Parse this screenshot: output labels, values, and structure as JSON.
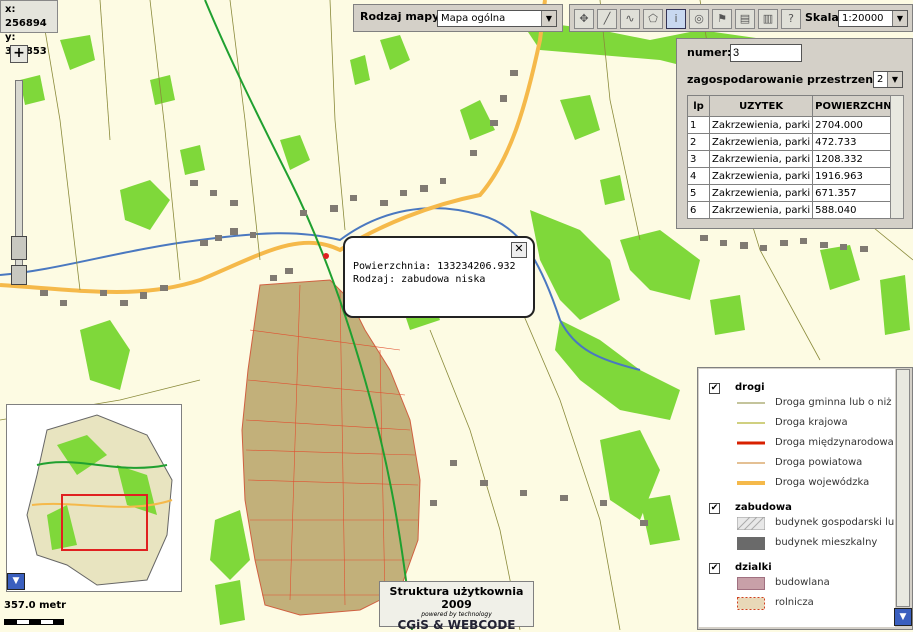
{
  "coords": {
    "x": "x: 256894",
    "y": "y: 340853"
  },
  "map_type": {
    "label": "Rodzaj mapy:",
    "value": "Mapa ogólna"
  },
  "toolbar": {
    "tools": [
      "move-icon",
      "ruler-icon",
      "measure-line-icon",
      "polygon-icon",
      "info-icon",
      "globe-icon",
      "flag-icon",
      "layers-icon",
      "print-icon",
      "help-icon"
    ],
    "scale_label": "Skala",
    "scale_value": "1:20000"
  },
  "info_panel": {
    "numer_label": "numer:",
    "numer_value": "3",
    "layer_label": "zagospodarowanie przestrzenne",
    "layer_value": "2",
    "columns": [
      "lp",
      "UZYTEK",
      "POWIERZCHNI"
    ],
    "rows": [
      [
        "1",
        "Zakrzewienia, parki",
        "2704.000"
      ],
      [
        "2",
        "Zakrzewienia, parki",
        "472.733"
      ],
      [
        "3",
        "Zakrzewienia, parki",
        "1208.332"
      ],
      [
        "4",
        "Zakrzewienia, parki",
        "1916.963"
      ],
      [
        "5",
        "Zakrzewienia, parki",
        "671.357"
      ],
      [
        "6",
        "Zakrzewienia, parki",
        "588.040"
      ]
    ]
  },
  "popup": {
    "line1": "Powierzchnia: 133234206.932",
    "line2": "Rodzaj: zabudowa niska",
    "close": "✕"
  },
  "legend": {
    "groups": [
      {
        "name": "drogi",
        "checked": true,
        "items": [
          {
            "label": "Droga gminna lub o niż",
            "color": "#8a8a3a",
            "style": "thin"
          },
          {
            "label": "Droga krajowa",
            "color": "#a0a000",
            "style": "thin"
          },
          {
            "label": "Droga międzynarodowa",
            "color": "#d82000",
            "style": "thick"
          },
          {
            "label": "Droga powiatowa",
            "color": "#c8822a",
            "style": "thin"
          },
          {
            "label": "Droga wojewódzka",
            "color": "#f5b94a",
            "style": "thick"
          }
        ]
      },
      {
        "name": "zabudowa",
        "checked": true,
        "items": [
          {
            "label": "budynek gospodarski lu",
            "color": "#c8c8c8",
            "style": "hatch"
          },
          {
            "label": "budynek mieszkalny",
            "color": "#6a6a6a",
            "style": "fill"
          }
        ]
      },
      {
        "name": "dzialki",
        "checked": true,
        "items": [
          {
            "label": "budowlana",
            "color": "#c8a0a8",
            "style": "fill"
          },
          {
            "label": "rolnicza",
            "color": "#e8d8b8",
            "style": "dashed"
          }
        ]
      }
    ]
  },
  "scale_bar": "357.0 metr",
  "branding": {
    "title": "Struktura użytkownia 2009",
    "powered": "powered by technology",
    "logo": "CGiS & WEBCODE"
  },
  "colors": {
    "map_bg": "#fdfbe3",
    "forest": "#7fd83a",
    "built_up": "#c2b07a",
    "road_main": "#f5b94a",
    "river": "#4a78c0",
    "rail": "#20a030"
  }
}
